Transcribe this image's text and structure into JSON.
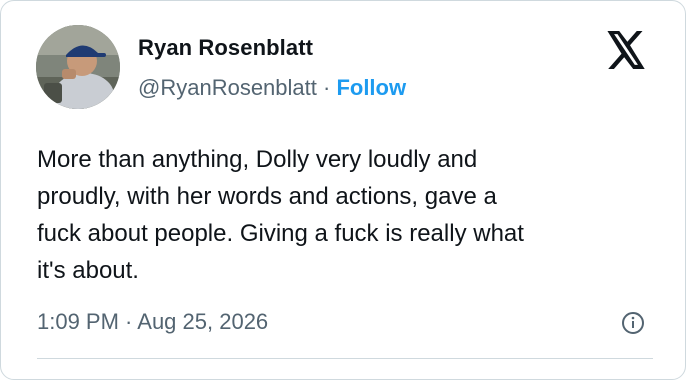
{
  "author": {
    "name": "Ryan Rosenblatt",
    "handle": "@RyanRosenblatt",
    "separator": " · ",
    "follow_label": "Follow"
  },
  "tweet": {
    "lines": [
      "More than anything, Dolly very loudly and",
      "proudly, with her words and actions, gave a",
      "fuck about people. Giving a fuck is really what",
      "it's about."
    ],
    "timestamp": "1:09 PM · Aug 25, 2026"
  },
  "icons": {
    "brand": "x-logo-icon",
    "info": "info-icon"
  },
  "colors": {
    "accent": "#1d9bf0",
    "text": "#0f1419",
    "secondary": "#536471",
    "border": "#cfd9de"
  }
}
